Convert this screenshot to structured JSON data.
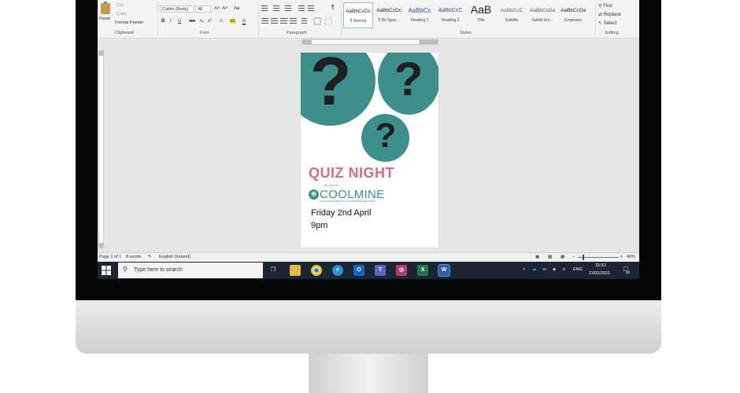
{
  "ribbon": {
    "clipboard": {
      "paste": "Paste",
      "cut": "Cut",
      "copy": "Copy",
      "format_painter": "Format Painter",
      "label": "Clipboard"
    },
    "font": {
      "family": "Calibri (Body)",
      "size": "48",
      "grow": "A˄",
      "shrink": "A˅",
      "case": "Aa",
      "bold": "B",
      "italic": "I",
      "underline": "U",
      "strike": "abc",
      "subscript": "x₂",
      "superscript": "x²",
      "text_effects": "A",
      "highlight": "ab",
      "font_color": "A",
      "label": "Font"
    },
    "paragraph": {
      "label": "Paragraph",
      "pilcrow": "¶"
    },
    "styles": {
      "label": "Styles",
      "items": [
        {
          "sample": "AaBbCcDc",
          "name": "¶ Normal"
        },
        {
          "sample": "AaBbCcDc",
          "name": "¶ No Spac..."
        },
        {
          "sample": "AaBbCc",
          "name": "Heading 1"
        },
        {
          "sample": "AaBbCcC",
          "name": "Heading 2"
        },
        {
          "sample": "AaB",
          "name": "Title"
        },
        {
          "sample": "AaBbCcC",
          "name": "Subtitle"
        },
        {
          "sample": "AaBbCcDa",
          "name": "Subtle Em..."
        },
        {
          "sample": "AaBbCcDa",
          "name": "Emphasis"
        }
      ]
    },
    "editing": {
      "find": "Find",
      "replace": "Replace",
      "select": "Select",
      "label": "Editing"
    }
  },
  "document": {
    "title": "QUIZ NIGHT",
    "in_aid": "IN AID OF",
    "logo_name": "COOLMINE",
    "logo_tagline": "COOLMINE ADDICTION SUPPORTING RECOVERY",
    "date_line": "Friday 2nd April",
    "time_line": "9pm"
  },
  "status_bar": {
    "page": "Page 1 of 1",
    "words": "8 words",
    "language": "English (Ireland)",
    "zoom": "40%"
  },
  "taskbar": {
    "search_placeholder": "Type here to search",
    "language": "ENG",
    "time": "15:51",
    "date": "11/03/2021",
    "notifications": "20"
  },
  "colors": {
    "teal": "#3d8f8c",
    "pink": "#d76b8a",
    "taskbar": "#1c2533"
  }
}
